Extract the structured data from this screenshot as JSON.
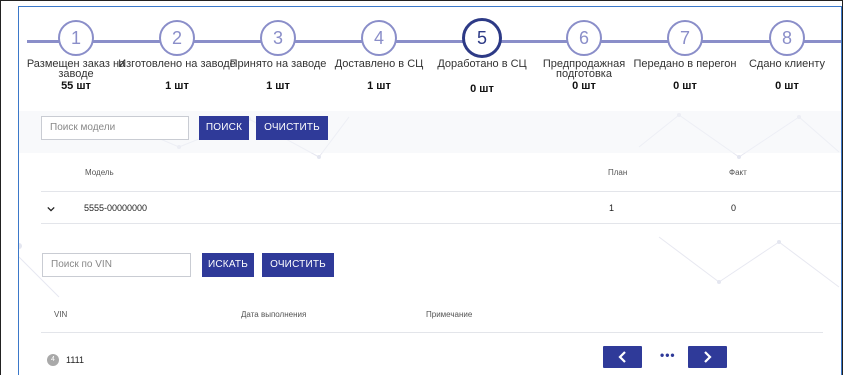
{
  "stepper": {
    "steps": [
      {
        "number": "1",
        "label": "Размещен заказ на заводе",
        "count": "55 шт",
        "active": false
      },
      {
        "number": "2",
        "label": "Изготовлено на заводе",
        "count": "1 шт",
        "active": false
      },
      {
        "number": "3",
        "label": "Принято на заводе",
        "count": "1 шт",
        "active": false
      },
      {
        "number": "4",
        "label": "Доставлено в СЦ",
        "count": "1 шт",
        "active": false
      },
      {
        "number": "5",
        "label": "Доработано в СЦ",
        "count": "0 шт",
        "active": true
      },
      {
        "number": "6",
        "label": "Предпродажная подготовка",
        "count": "0 шт",
        "active": false
      },
      {
        "number": "7",
        "label": "Передано в перегон",
        "count": "0 шт",
        "active": false
      },
      {
        "number": "8",
        "label": "Сдано клиенту",
        "count": "0 шт",
        "active": false
      }
    ],
    "colors": {
      "line": "#8a8ec9",
      "active": "#2d3a86"
    }
  },
  "model_search": {
    "placeholder": "Поиск модели",
    "search_label": "ПОИСК",
    "clear_label": "ОЧИСТИТЬ"
  },
  "model_table": {
    "headers": {
      "model": "Модель",
      "plan": "План",
      "fact": "Факт"
    },
    "rows": [
      {
        "model": "5555-00000000",
        "plan": "1",
        "fact": "0"
      }
    ]
  },
  "vin_search": {
    "placeholder": "Поиск по VIN",
    "search_label": "ИСКАТЬ",
    "clear_label": "ОЧИСТИТЬ"
  },
  "vin_table": {
    "headers": {
      "vin": "VIN",
      "date": "Дата выполнения",
      "note": "Примечание"
    },
    "rows": [
      {
        "index": "4",
        "vin": "1111"
      }
    ]
  },
  "pagination": {
    "prev_icon": "chevron-left-icon",
    "next_icon": "chevron-right-icon",
    "ellipsis": "•••"
  },
  "accent_color": "#2f3a99"
}
